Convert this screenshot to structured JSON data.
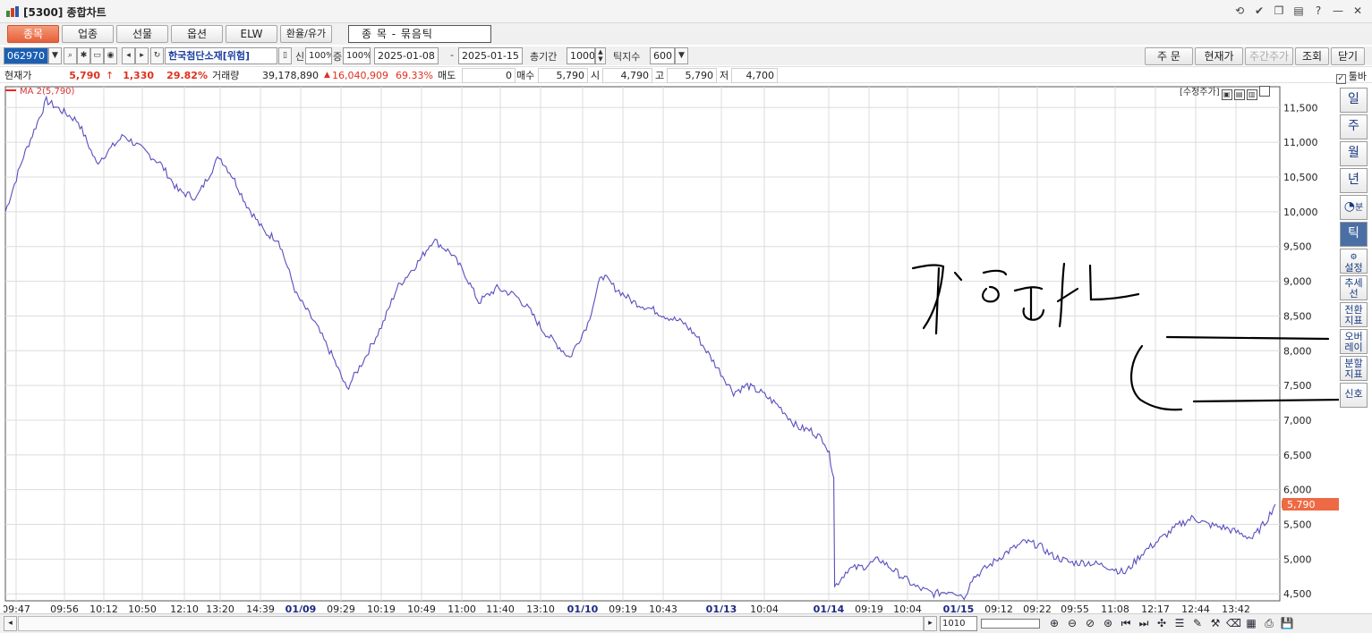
{
  "window": {
    "title": "[5300] 종합차트",
    "controls": [
      "restore-icon",
      "check-icon",
      "copy-icon",
      "print-icon",
      "help-icon",
      "minimize-icon",
      "close-icon"
    ]
  },
  "tabs": [
    {
      "label": "종목",
      "active": true
    },
    {
      "label": "업종",
      "active": false
    },
    {
      "label": "선물",
      "active": false
    },
    {
      "label": "옵션",
      "active": false
    },
    {
      "label": "ELW",
      "active": false
    },
    {
      "label": "환율/유가",
      "active": false
    }
  ],
  "group_selector": "종          목  -  묶음틱",
  "controls": {
    "stock_code": "062970",
    "stock_name": "한국첨단소재[위험]",
    "sin_label": "신",
    "sin_value": "100%",
    "jeung_label": "증",
    "jeung_value": "100%",
    "date_from": "2025-01-08",
    "date_sep": "-",
    "date_to": "2025-01-15",
    "total_period_label": "총기간",
    "total_period_value": "1000",
    "tick_count_label": "틱지수",
    "tick_count_value": "600"
  },
  "right_buttons": [
    "주  문",
    "현재가",
    "주간주가",
    "조회",
    "닫기"
  ],
  "quote": {
    "current_price_label": "현재가",
    "current_price": "5,790",
    "change_arrow": "↑",
    "change": "1,330",
    "change_rate": "29.82%",
    "volume_label": "거래량",
    "volume": "39,178,890",
    "volume_change_arrow": "▲",
    "volume_change": "16,040,909",
    "volume_rate": "69.33%",
    "sell_label": "매도",
    "sell_value": "0",
    "buy_label": "매수",
    "buy_value": "5,790",
    "open_label": "시",
    "open_value": "4,790",
    "high_label": "고",
    "high_value": "5,790",
    "low_label": "저",
    "low_value": "4,700",
    "toolbar_label": "툴바",
    "toolbar_checked": true
  },
  "legend": {
    "label": "MA 2(5,790)",
    "color": "#e22222"
  },
  "adjusted_price_label": "[수정주가]",
  "side_panel": [
    {
      "label": "일",
      "kind": "text"
    },
    {
      "label": "주",
      "kind": "text"
    },
    {
      "label": "월",
      "kind": "text"
    },
    {
      "label": "년",
      "kind": "text"
    },
    {
      "icon": "clock-minute-icon",
      "label": "분",
      "kind": "text"
    },
    {
      "label": "틱",
      "kind": "text",
      "selected": true
    },
    {
      "label": "설정",
      "kind": "text"
    },
    {
      "label": "추세선",
      "kind": "text"
    },
    {
      "label": "전환지표",
      "kind": "text"
    },
    {
      "label": "오버레이",
      "kind": "text"
    },
    {
      "label": "분할지표",
      "kind": "text"
    },
    {
      "label": "신호",
      "kind": "text"
    }
  ],
  "bottom": {
    "zoom_value": "1010",
    "icons": [
      "zoom-in-icon",
      "zoom-out-icon",
      "zoom-reset-icon",
      "zoom-fit-icon",
      "first-icon",
      "last-icon",
      "crosshair-icon",
      "settings-icon",
      "draw-icon",
      "tools-icon",
      "eraser-icon",
      "grid-icon",
      "print-icon",
      "save-icon"
    ]
  },
  "chart_data": {
    "type": "line",
    "series": [
      {
        "name": "MA 2",
        "color": "#5050c8",
        "x_index": [
          0,
          20,
          45,
          80,
          100,
          130,
          150,
          170,
          190,
          210,
          235,
          250,
          265,
          285,
          300,
          320,
          340,
          360,
          375,
          395,
          415,
          430,
          455,
          470,
          490,
          505,
          520,
          540,
          560,
          575,
          590,
          605,
          620,
          640,
          655,
          670,
          690,
          710,
          725,
          745,
          760,
          780,
          800,
          815,
          830,
          850,
          870,
          885,
          900,
          905,
          910,
          911,
          925,
          945,
          960,
          980,
          1000,
          1020,
          1040,
          1055,
          1060,
          1080,
          1100,
          1120,
          1135,
          1150,
          1170,
          1190,
          1210,
          1230,
          1250,
          1270,
          1290,
          1305,
          1320,
          1340,
          1360,
          1370,
          1385,
          1395
        ],
        "values": [
          10000,
          10800,
          11600,
          11300,
          10700,
          11100,
          10900,
          10700,
          10300,
          10200,
          10800,
          10500,
          10100,
          9700,
          9600,
          8800,
          8400,
          7900,
          7450,
          7900,
          8400,
          8900,
          9300,
          9600,
          9400,
          9100,
          8700,
          8900,
          8800,
          8600,
          8300,
          8100,
          7900,
          8400,
          9100,
          8900,
          8700,
          8600,
          8500,
          8400,
          8200,
          7800,
          7400,
          7500,
          7400,
          7200,
          6900,
          6850,
          6700,
          6500,
          6200,
          4600,
          4850,
          4900,
          5000,
          4800,
          4600,
          4500,
          4550,
          4450,
          4700,
          4900,
          5100,
          5250,
          5200,
          5050,
          4950,
          4950,
          4900,
          4800,
          5100,
          5300,
          5500,
          5600,
          5500,
          5450,
          5350,
          5300,
          5550,
          5790
        ]
      }
    ],
    "y_ticks": [
      4500,
      5000,
      5500,
      6000,
      6500,
      7000,
      7500,
      8000,
      8500,
      9000,
      9500,
      10000,
      10500,
      11000,
      11500
    ],
    "y_tick_labels": [
      "4,500",
      "5,000",
      "5,500",
      "6,000",
      "6,500",
      "7,000",
      "7,500",
      "8,000",
      "8,500",
      "9,000",
      "9,500",
      "10,000",
      "10,500",
      "11,000",
      "11,500"
    ],
    "ylim": [
      4400,
      11800
    ],
    "x_ticks": [
      {
        "label": "09:47",
        "pos": 12,
        "bold": false
      },
      {
        "label": "09:56",
        "pos": 66,
        "bold": false
      },
      {
        "label": "10:12",
        "pos": 110,
        "bold": false
      },
      {
        "label": "10:50",
        "pos": 153,
        "bold": false
      },
      {
        "label": "12:10",
        "pos": 200,
        "bold": false
      },
      {
        "label": "13:20",
        "pos": 240,
        "bold": false
      },
      {
        "label": "14:39",
        "pos": 285,
        "bold": false
      },
      {
        "label": "01/09",
        "pos": 330,
        "bold": true
      },
      {
        "label": "09:29",
        "pos": 375,
        "bold": false
      },
      {
        "label": "10:19",
        "pos": 420,
        "bold": false
      },
      {
        "label": "10:49",
        "pos": 465,
        "bold": false
      },
      {
        "label": "11:00",
        "pos": 510,
        "bold": false
      },
      {
        "label": "11:40",
        "pos": 553,
        "bold": false
      },
      {
        "label": "13:10",
        "pos": 598,
        "bold": false
      },
      {
        "label": "01/10",
        "pos": 645,
        "bold": true
      },
      {
        "label": "09:19",
        "pos": 690,
        "bold": false
      },
      {
        "label": "10:43",
        "pos": 735,
        "bold": false
      },
      {
        "label": "01/13",
        "pos": 800,
        "bold": true
      },
      {
        "label": "10:04",
        "pos": 848,
        "bold": false
      },
      {
        "label": "01/14",
        "pos": 920,
        "bold": true
      },
      {
        "label": "09:19",
        "pos": 965,
        "bold": false
      },
      {
        "label": "10:04",
        "pos": 1008,
        "bold": false
      },
      {
        "label": "01/15",
        "pos": 1065,
        "bold": true
      },
      {
        "label": "09:12",
        "pos": 1110,
        "bold": false
      },
      {
        "label": "09:22",
        "pos": 1153,
        "bold": false
      },
      {
        "label": "09:55",
        "pos": 1195,
        "bold": false
      },
      {
        "label": "11:08",
        "pos": 1240,
        "bold": false
      },
      {
        "label": "12:17",
        "pos": 1285,
        "bold": false
      },
      {
        "label": "12:44",
        "pos": 1330,
        "bold": false
      },
      {
        "label": "13:42",
        "pos": 1375,
        "bold": false
      }
    ],
    "x_count": 1400,
    "last_price_label": "5,790",
    "last_price_value": 5790,
    "grid": true,
    "handwriting": {
      "text": "거 랑 사",
      "color": "#000000"
    }
  }
}
